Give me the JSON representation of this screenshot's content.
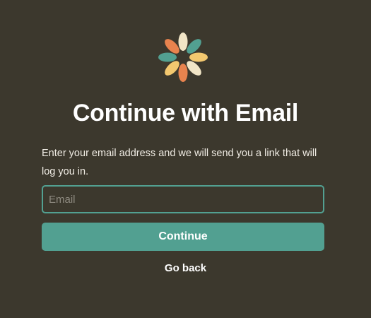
{
  "logo": {
    "icon": "pinwheel-logo-icon",
    "colors": {
      "orange": "#e8834e",
      "teal": "#52a091",
      "yellow": "#f3c86f",
      "cream": "#f1e5c6"
    }
  },
  "heading": {
    "title": "Continue with Email",
    "description": "Enter your email address and we will send you a link that will log you in."
  },
  "form": {
    "email_placeholder": "Email",
    "email_value": "",
    "continue_label": "Continue",
    "go_back_label": "Go back"
  },
  "colors": {
    "background": "#3c382d",
    "accent": "#52a091",
    "text": "#ffffff"
  }
}
